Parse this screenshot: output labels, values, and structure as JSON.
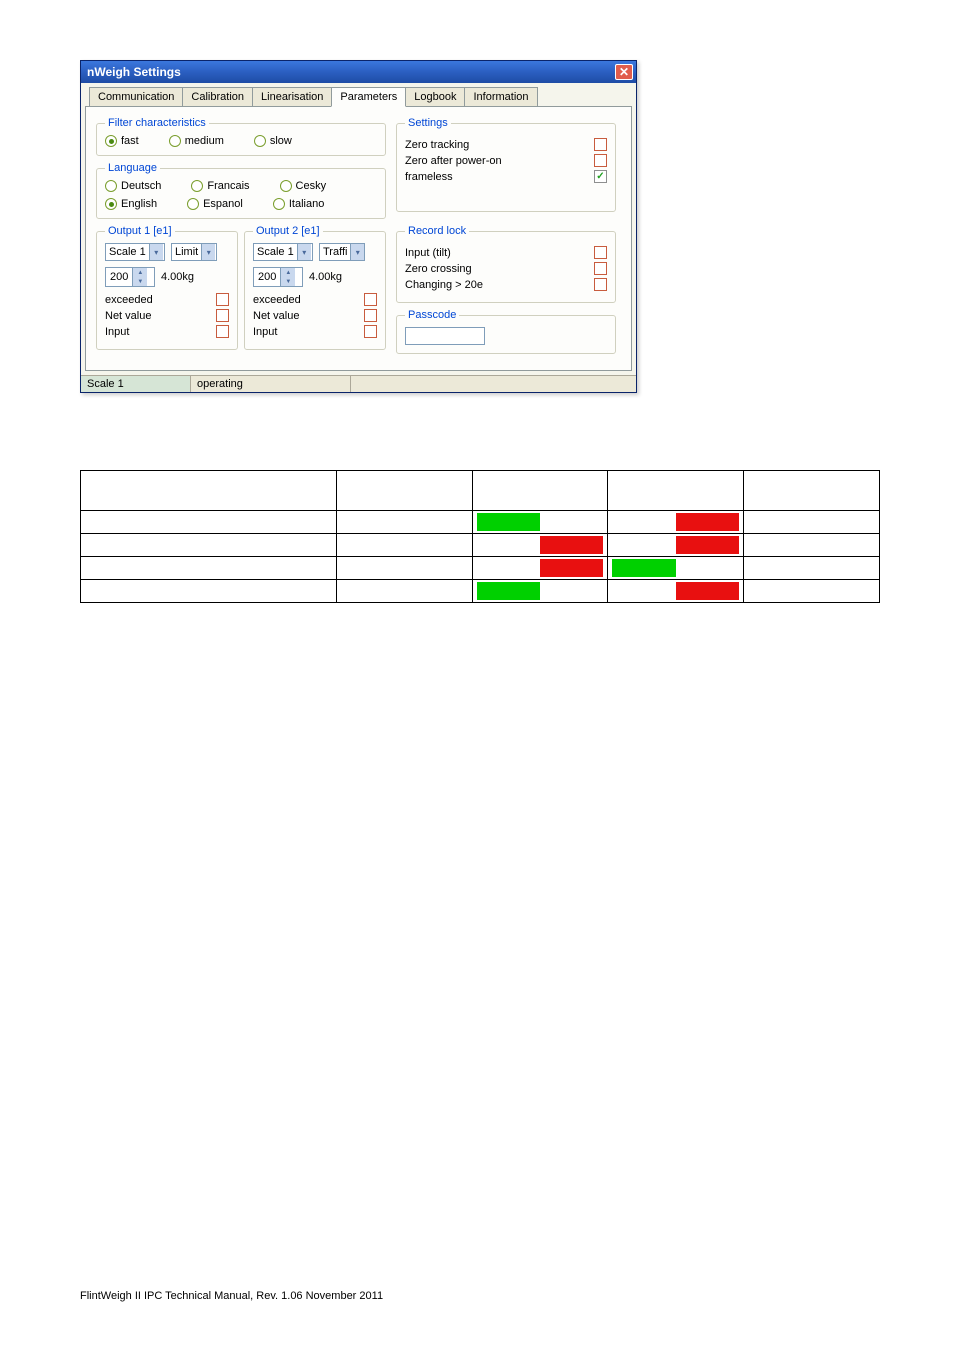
{
  "window": {
    "title": "nWeigh Settings"
  },
  "tabs": [
    "Communication",
    "Calibration",
    "Linearisation",
    "Parameters",
    "Logbook",
    "Information"
  ],
  "active_tab": "Parameters",
  "filter": {
    "legend": "Filter characteristics",
    "options": [
      "fast",
      "medium",
      "slow"
    ],
    "selected": "fast"
  },
  "language": {
    "legend": "Language",
    "options": [
      "Deutsch",
      "Francais",
      "Cesky",
      "English",
      "Espanol",
      "Italiano"
    ],
    "selected": "English"
  },
  "settings": {
    "legend": "Settings",
    "items": {
      "zero_tracking": "Zero tracking",
      "zero_after_power": "Zero after power-on",
      "frameless": "frameless"
    },
    "frameless_checked": "✓"
  },
  "output1": {
    "legend": "Output 1 [e1]",
    "scale_label": "Scale 1",
    "mode_label": "Limit",
    "value": "200",
    "unit": "4.00kg",
    "rows": {
      "exceeded": "exceeded",
      "netvalue": "Net value",
      "input": "Input"
    }
  },
  "output2": {
    "legend": "Output 2 [e1]",
    "scale_label": "Scale 1",
    "mode_label": "Traffi",
    "value": "200",
    "unit": "4.00kg",
    "rows": {
      "exceeded": "exceeded",
      "netvalue": "Net value",
      "input": "Input"
    }
  },
  "recordlock": {
    "legend": "Record lock",
    "items": {
      "input_tilt": "Input (tilt)",
      "zero_crossing": "Zero crossing",
      "changing": "Changing > 20e"
    }
  },
  "passcode": {
    "legend": "Passcode"
  },
  "statusbar": {
    "scale": "Scale 1",
    "state": "operating"
  },
  "footer": "FlintWeigh II IPC Technical Manual, Rev. 1.06   November 2011"
}
